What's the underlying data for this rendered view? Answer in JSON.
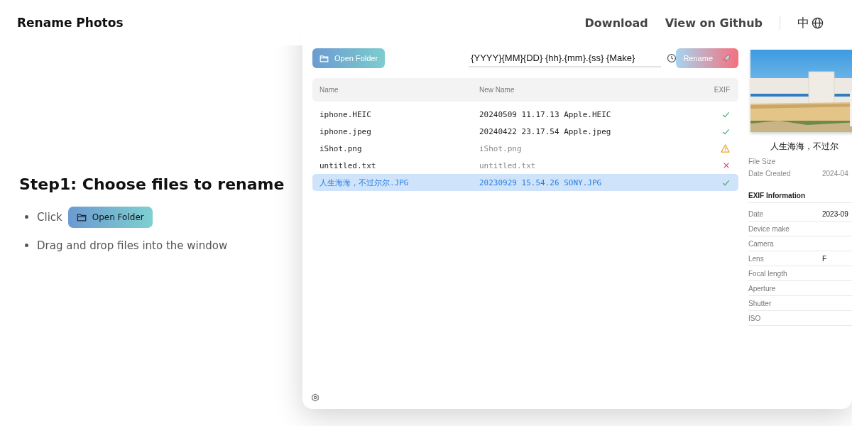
{
  "header": {
    "brand": "Rename Photos",
    "links": [
      "Download",
      "View on Github"
    ],
    "language": "中"
  },
  "intro": {
    "title": "Step1: Choose files to rename",
    "steps": [
      {
        "kind": "button",
        "text": "Click",
        "button": "Open Folder"
      },
      {
        "kind": "text",
        "text": "Drag and drop files into the window"
      }
    ]
  },
  "app": {
    "open_button": "Open Folder",
    "pattern": "{YYYY}{MM}{DD} {hh}.{mm}.{ss} {Make}",
    "rename_button": "Rename",
    "columns": [
      "Name",
      "New Name",
      "EXIF"
    ],
    "rows": [
      {
        "name": "iphone.HEIC",
        "new_name": "20240509 11.17.13 Apple.HEIC",
        "renamed": true,
        "kind": "ok",
        "selected": false
      },
      {
        "name": "iphone.jpeg",
        "new_name": "20240422 23.17.54 Apple.jpeg",
        "renamed": true,
        "kind": "ok",
        "selected": false
      },
      {
        "name": "iShot.png",
        "new_name": "iShot.png",
        "renamed": false,
        "kind": "warning",
        "selected": false
      },
      {
        "name": "untitled.txt",
        "new_name": "untitled.txt",
        "renamed": false,
        "kind": "error",
        "selected": false
      },
      {
        "name": "人生海海，不过尔尔.JPG",
        "new_name": "20230929 15.54.26 SONY.JPG",
        "renamed": true,
        "kind": "ok",
        "selected": true
      }
    ],
    "preview": {
      "kind": "picture",
      "file_name": "人生海海，不过尔",
      "file_info": [
        {
          "label": "File Size"
        },
        {
          "label": "Date Created",
          "value": "2024-04"
        }
      ],
      "exif_title": "EXIF Information",
      "exif": [
        {
          "label": "Date",
          "value": "2023-09"
        },
        {
          "label": "Device make"
        },
        {
          "label": "Camera"
        },
        {
          "label": "Lens",
          "value": "F"
        },
        {
          "label": "Focal length"
        },
        {
          "label": "Aperture"
        },
        {
          "label": "Shutter"
        },
        {
          "label": "ISO"
        }
      ]
    }
  }
}
